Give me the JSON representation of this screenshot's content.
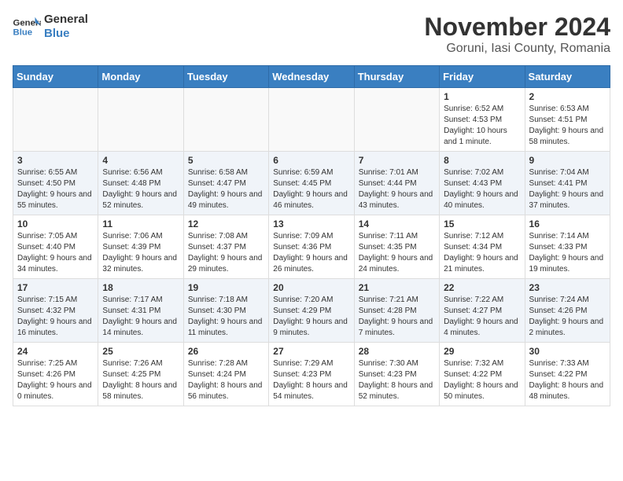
{
  "logo": {
    "line1": "General",
    "line2": "Blue"
  },
  "title": "November 2024",
  "subtitle": "Goruni, Iasi County, Romania",
  "days_of_week": [
    "Sunday",
    "Monday",
    "Tuesday",
    "Wednesday",
    "Thursday",
    "Friday",
    "Saturday"
  ],
  "weeks": [
    [
      {
        "day": "",
        "info": ""
      },
      {
        "day": "",
        "info": ""
      },
      {
        "day": "",
        "info": ""
      },
      {
        "day": "",
        "info": ""
      },
      {
        "day": "",
        "info": ""
      },
      {
        "day": "1",
        "info": "Sunrise: 6:52 AM\nSunset: 4:53 PM\nDaylight: 10 hours and 1 minute."
      },
      {
        "day": "2",
        "info": "Sunrise: 6:53 AM\nSunset: 4:51 PM\nDaylight: 9 hours and 58 minutes."
      }
    ],
    [
      {
        "day": "3",
        "info": "Sunrise: 6:55 AM\nSunset: 4:50 PM\nDaylight: 9 hours and 55 minutes."
      },
      {
        "day": "4",
        "info": "Sunrise: 6:56 AM\nSunset: 4:48 PM\nDaylight: 9 hours and 52 minutes."
      },
      {
        "day": "5",
        "info": "Sunrise: 6:58 AM\nSunset: 4:47 PM\nDaylight: 9 hours and 49 minutes."
      },
      {
        "day": "6",
        "info": "Sunrise: 6:59 AM\nSunset: 4:45 PM\nDaylight: 9 hours and 46 minutes."
      },
      {
        "day": "7",
        "info": "Sunrise: 7:01 AM\nSunset: 4:44 PM\nDaylight: 9 hours and 43 minutes."
      },
      {
        "day": "8",
        "info": "Sunrise: 7:02 AM\nSunset: 4:43 PM\nDaylight: 9 hours and 40 minutes."
      },
      {
        "day": "9",
        "info": "Sunrise: 7:04 AM\nSunset: 4:41 PM\nDaylight: 9 hours and 37 minutes."
      }
    ],
    [
      {
        "day": "10",
        "info": "Sunrise: 7:05 AM\nSunset: 4:40 PM\nDaylight: 9 hours and 34 minutes."
      },
      {
        "day": "11",
        "info": "Sunrise: 7:06 AM\nSunset: 4:39 PM\nDaylight: 9 hours and 32 minutes."
      },
      {
        "day": "12",
        "info": "Sunrise: 7:08 AM\nSunset: 4:37 PM\nDaylight: 9 hours and 29 minutes."
      },
      {
        "day": "13",
        "info": "Sunrise: 7:09 AM\nSunset: 4:36 PM\nDaylight: 9 hours and 26 minutes."
      },
      {
        "day": "14",
        "info": "Sunrise: 7:11 AM\nSunset: 4:35 PM\nDaylight: 9 hours and 24 minutes."
      },
      {
        "day": "15",
        "info": "Sunrise: 7:12 AM\nSunset: 4:34 PM\nDaylight: 9 hours and 21 minutes."
      },
      {
        "day": "16",
        "info": "Sunrise: 7:14 AM\nSunset: 4:33 PM\nDaylight: 9 hours and 19 minutes."
      }
    ],
    [
      {
        "day": "17",
        "info": "Sunrise: 7:15 AM\nSunset: 4:32 PM\nDaylight: 9 hours and 16 minutes."
      },
      {
        "day": "18",
        "info": "Sunrise: 7:17 AM\nSunset: 4:31 PM\nDaylight: 9 hours and 14 minutes."
      },
      {
        "day": "19",
        "info": "Sunrise: 7:18 AM\nSunset: 4:30 PM\nDaylight: 9 hours and 11 minutes."
      },
      {
        "day": "20",
        "info": "Sunrise: 7:20 AM\nSunset: 4:29 PM\nDaylight: 9 hours and 9 minutes."
      },
      {
        "day": "21",
        "info": "Sunrise: 7:21 AM\nSunset: 4:28 PM\nDaylight: 9 hours and 7 minutes."
      },
      {
        "day": "22",
        "info": "Sunrise: 7:22 AM\nSunset: 4:27 PM\nDaylight: 9 hours and 4 minutes."
      },
      {
        "day": "23",
        "info": "Sunrise: 7:24 AM\nSunset: 4:26 PM\nDaylight: 9 hours and 2 minutes."
      }
    ],
    [
      {
        "day": "24",
        "info": "Sunrise: 7:25 AM\nSunset: 4:26 PM\nDaylight: 9 hours and 0 minutes."
      },
      {
        "day": "25",
        "info": "Sunrise: 7:26 AM\nSunset: 4:25 PM\nDaylight: 8 hours and 58 minutes."
      },
      {
        "day": "26",
        "info": "Sunrise: 7:28 AM\nSunset: 4:24 PM\nDaylight: 8 hours and 56 minutes."
      },
      {
        "day": "27",
        "info": "Sunrise: 7:29 AM\nSunset: 4:23 PM\nDaylight: 8 hours and 54 minutes."
      },
      {
        "day": "28",
        "info": "Sunrise: 7:30 AM\nSunset: 4:23 PM\nDaylight: 8 hours and 52 minutes."
      },
      {
        "day": "29",
        "info": "Sunrise: 7:32 AM\nSunset: 4:22 PM\nDaylight: 8 hours and 50 minutes."
      },
      {
        "day": "30",
        "info": "Sunrise: 7:33 AM\nSunset: 4:22 PM\nDaylight: 8 hours and 48 minutes."
      }
    ]
  ]
}
